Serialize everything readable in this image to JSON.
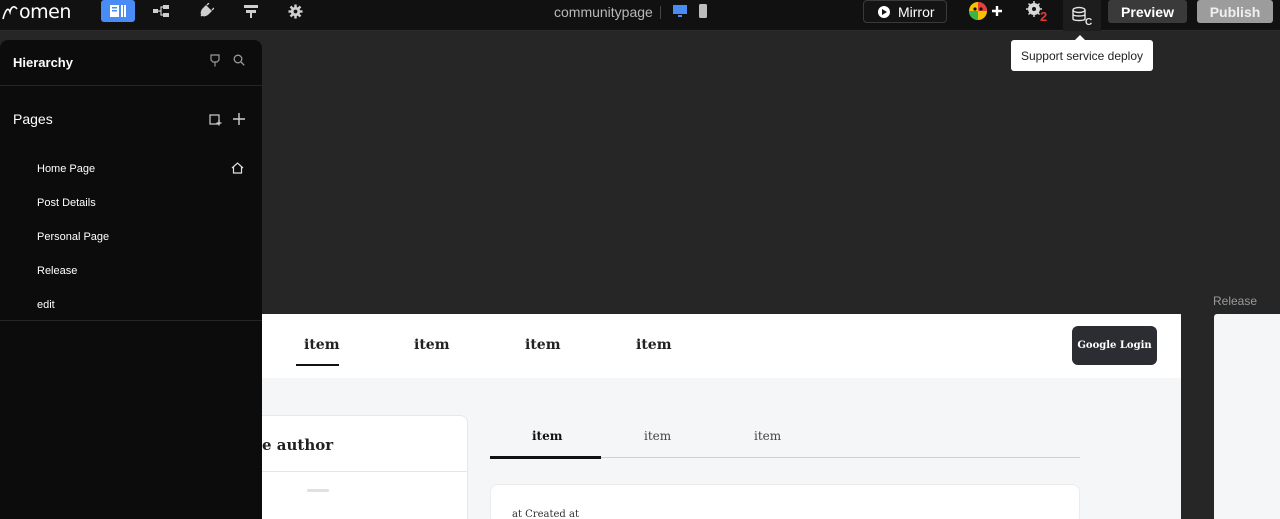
{
  "app": {
    "logo_text": "omen",
    "project_name": "communitypage"
  },
  "toolbar": {
    "mirror_label": "Mirror",
    "preview_label": "Preview",
    "publish_label": "Publish",
    "ai_badge_count": "2",
    "db_badge_letter": "C",
    "tooltip": "Support service deploy"
  },
  "hierarchy": {
    "title": "Hierarchy",
    "pages_title": "Pages",
    "pages": [
      {
        "label": "Home Page",
        "is_home": true
      },
      {
        "label": "Post Details"
      },
      {
        "label": "Personal Page"
      },
      {
        "label": "Release"
      },
      {
        "label": "edit"
      }
    ]
  },
  "canvas": {
    "nav_items": [
      "item",
      "item",
      "item",
      "item"
    ],
    "login_button": "Google Login",
    "author_title": "e author",
    "tabs": [
      "item",
      "item",
      "item"
    ],
    "post_meta": "at Created  at"
  },
  "release_frame_label": "Release",
  "colors": {
    "accent": "#4a8cf5",
    "topbar_bg": "#111111",
    "canvas_bg": "#262626",
    "panel_bg": "#0c0c0c"
  }
}
